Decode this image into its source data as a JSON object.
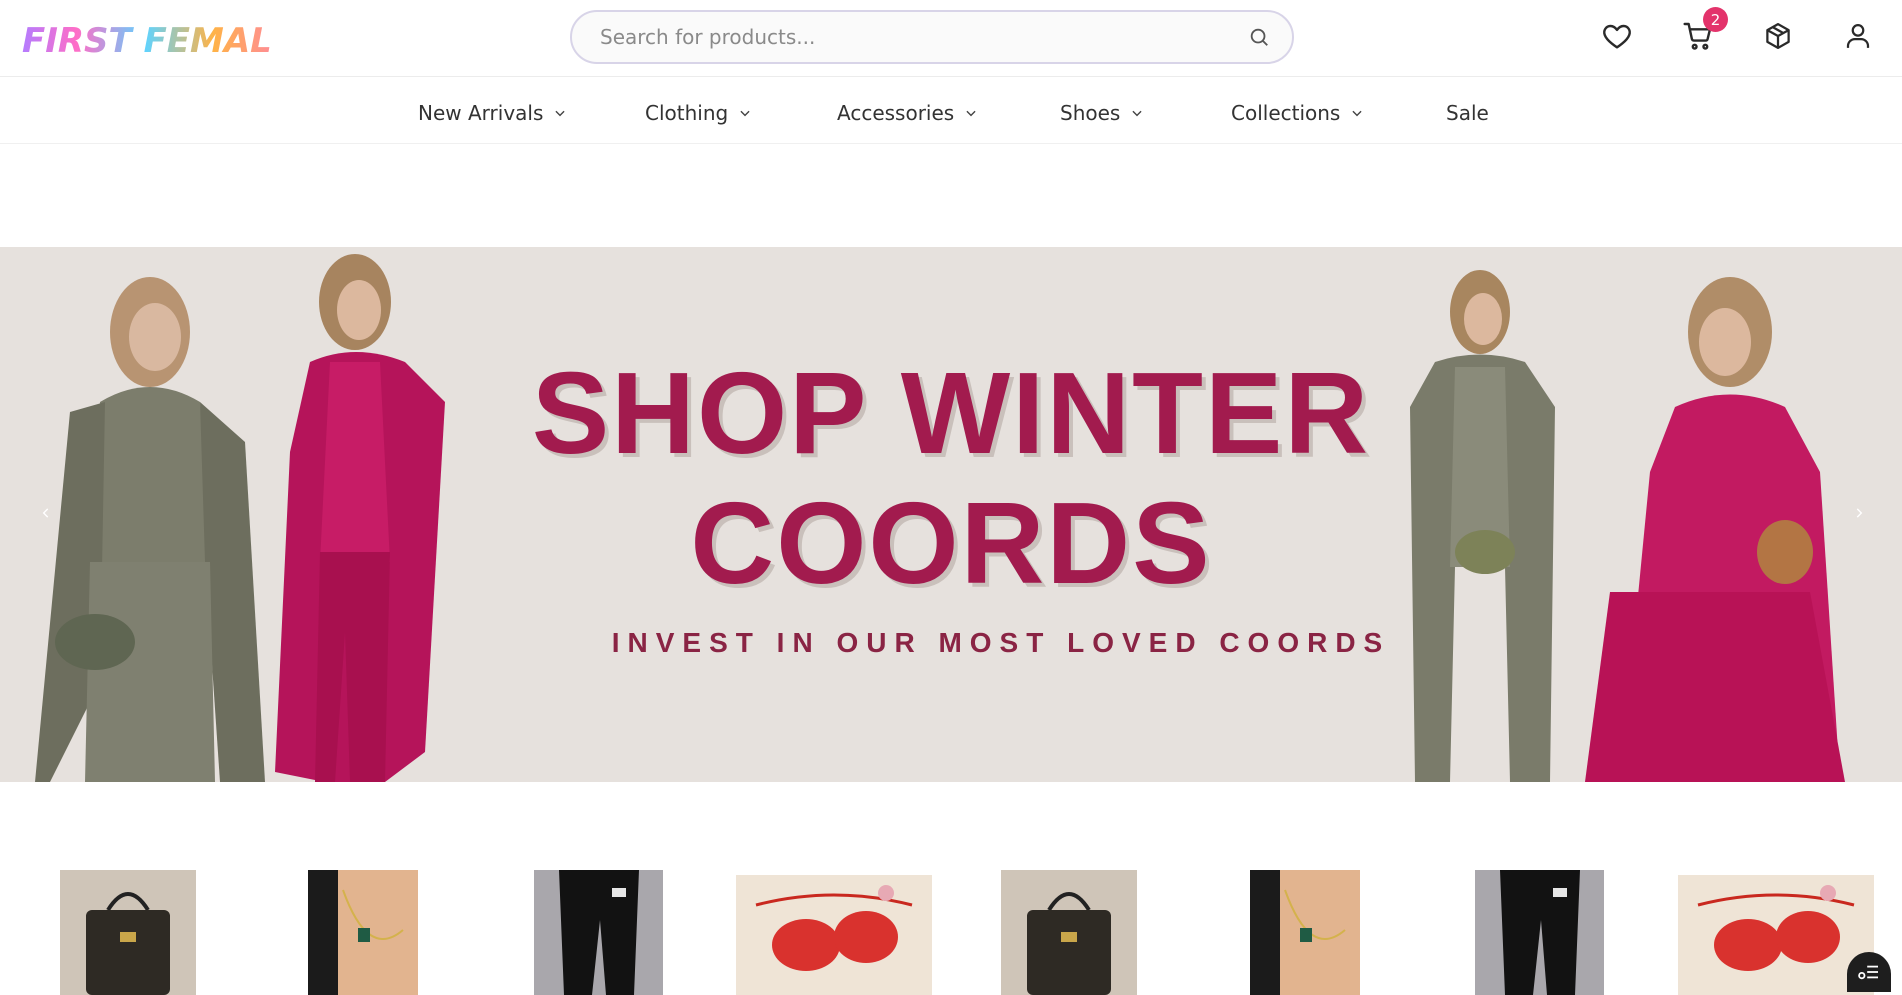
{
  "header": {
    "logo_text": "FIRST FEMALE",
    "search_placeholder": "Search for products...",
    "cart_count": "2",
    "icons": [
      "heart-icon",
      "cart-icon",
      "package-icon",
      "user-icon",
      "search-icon"
    ]
  },
  "nav": {
    "items": [
      {
        "label": "New Arrivals",
        "has_dropdown": true
      },
      {
        "label": "Clothing",
        "has_dropdown": true
      },
      {
        "label": "Accessories",
        "has_dropdown": true
      },
      {
        "label": "Shoes",
        "has_dropdown": true
      },
      {
        "label": "Collections",
        "has_dropdown": true
      },
      {
        "label": "Sale",
        "has_dropdown": false
      }
    ]
  },
  "hero": {
    "title_line1": "SHOP WINTER",
    "title_line2": "COORDS",
    "subtitle": "INVEST IN OUR MOST LOVED COORDS"
  },
  "products": {
    "items": [
      "handbag",
      "necklace",
      "leggings",
      "lingerie",
      "handbag",
      "necklace",
      "leggings",
      "lingerie"
    ]
  },
  "colors": {
    "accent": "#a21b4e",
    "badge": "#e3336b",
    "hero_bg": "#e6e1dd"
  }
}
